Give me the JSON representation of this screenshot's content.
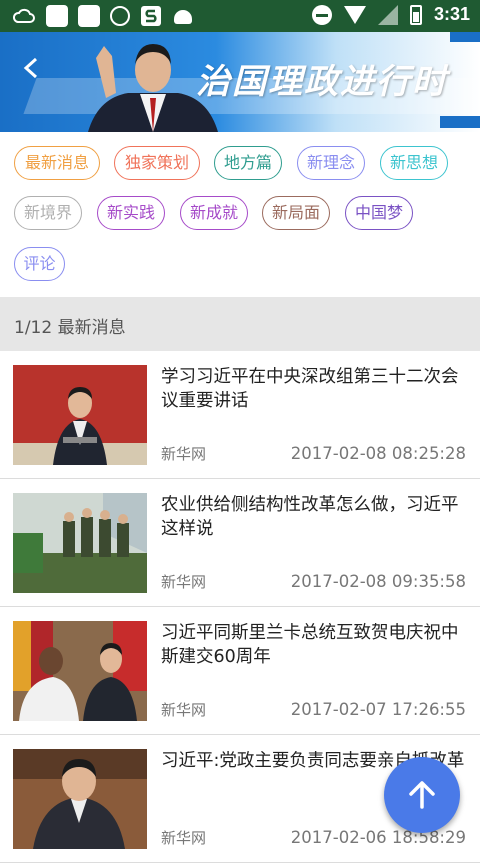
{
  "status_bar": {
    "time": "3:31",
    "icons": [
      "cloud-icon",
      "notification-icon",
      "notification-icon",
      "map-pin-icon",
      "s-app-icon",
      "android-icon",
      "do-not-disturb-icon",
      "wifi-icon",
      "signal-icon",
      "battery-icon"
    ]
  },
  "banner": {
    "title": "治国理政进行时",
    "back_icon": "back-arrow-icon",
    "colors": {
      "primary": "#1a6fc6",
      "light": "#bfe0f7"
    }
  },
  "tags": [
    {
      "label": "最新消息",
      "color": "#f0a043"
    },
    {
      "label": "独家策划",
      "color": "#f0735a"
    },
    {
      "label": "地方篇",
      "color": "#2f9d8f"
    },
    {
      "label": "新理念",
      "color": "#8a8ef0"
    },
    {
      "label": "新思想",
      "color": "#3dc4cf"
    },
    {
      "label": "新境界",
      "color": "#b0b0b0"
    },
    {
      "label": "新实践",
      "color": "#a64bc9"
    },
    {
      "label": "新成就",
      "color": "#a64bc9"
    },
    {
      "label": "新局面",
      "color": "#9b6b5e"
    },
    {
      "label": "中国梦",
      "color": "#7a52c4"
    },
    {
      "label": "评论",
      "color": "#8a8ef0"
    }
  ],
  "section": {
    "page": "1/12",
    "name": "最新消息"
  },
  "news": [
    {
      "title": "学习习近平在中央深改组第三十二次会议重要讲话",
      "source": "新华网",
      "time": "2017-02-08 08:25:28"
    },
    {
      "title": "农业供给侧结构性改革怎么做，习近平这样说",
      "source": "新华网",
      "time": "2017-02-08 09:35:58"
    },
    {
      "title": "习近平同斯里兰卡总统互致贺电庆祝中斯建交60周年",
      "source": "新华网",
      "time": "2017-02-07 17:26:55"
    },
    {
      "title": "习近平:党政主要负责同志要亲自抓改革",
      "source": "新华网",
      "time": "2017-02-06 18:58:29"
    }
  ],
  "fab": {
    "icon": "arrow-up-icon",
    "color": "#4a7ae8"
  }
}
